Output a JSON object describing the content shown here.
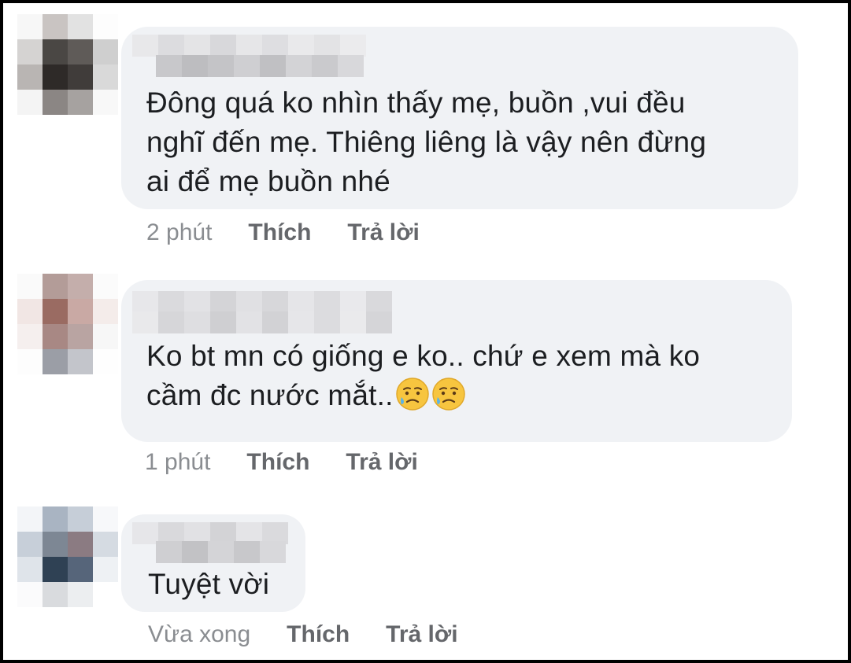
{
  "comments": [
    {
      "text": "Đông quá ko nhìn thấy mẹ, buồn ,vui đều\nnghĩ đến mẹ. Thiêng liêng là vậy nên đừng\nai để mẹ buồn nhé",
      "time": "2 phút",
      "like_label": "Thích",
      "reply_label": "Trả lời"
    },
    {
      "text": "Ko bt mn có giống e ko.. chứ e xem mà ko\ncầm đc nước mắt..",
      "emoji": [
        "sad-but-relieved-face-icon",
        "sad-but-relieved-face-icon"
      ],
      "time": "1 phút",
      "like_label": "Thích",
      "reply_label": "Trả lời"
    },
    {
      "text": "Tuyệt vời",
      "time": "Vừa xong",
      "like_label": "Thích",
      "reply_label": "Trả lời"
    }
  ],
  "colors": {
    "bubble": "#f0f2f5",
    "text": "#1c1e21",
    "meta": "#65676b"
  }
}
